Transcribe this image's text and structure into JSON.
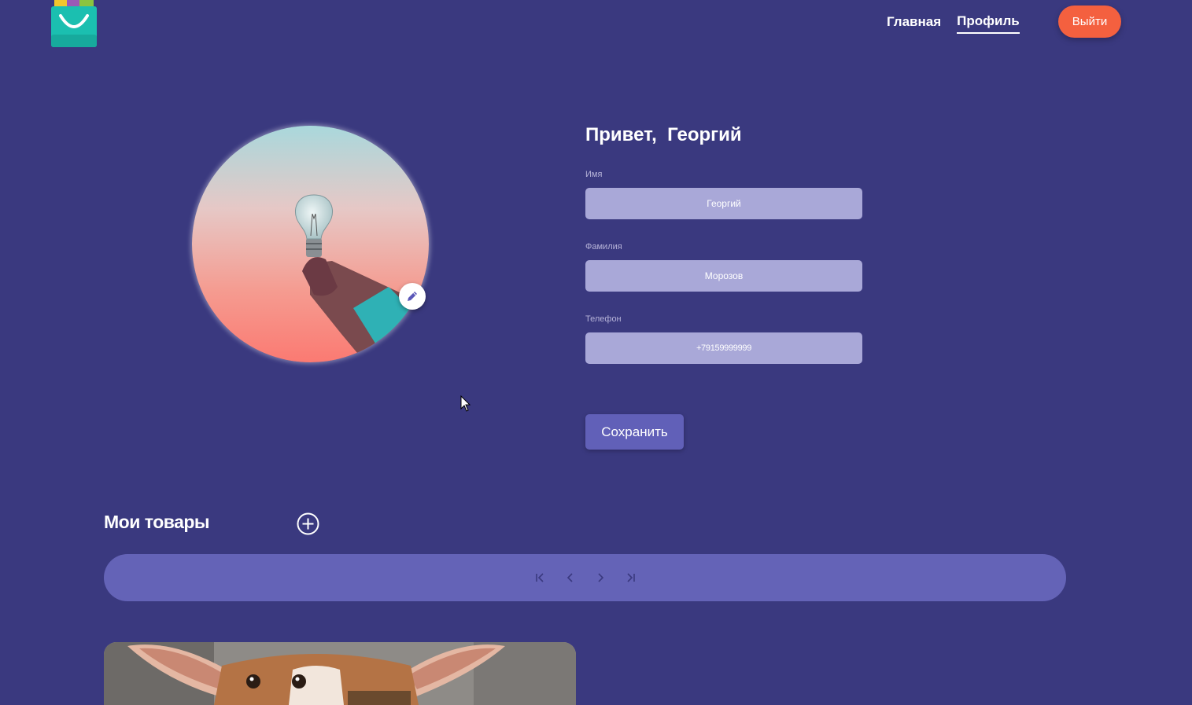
{
  "header": {
    "nav": [
      {
        "label": "Главная",
        "active": false
      },
      {
        "label": "Профиль",
        "active": true
      }
    ],
    "logout_label": "Выйти"
  },
  "profile": {
    "greeting_prefix": "Привет,",
    "user_name": "Георгий",
    "fields": [
      {
        "label": "Имя",
        "value": "Георгий"
      },
      {
        "label": "Фамилия",
        "value": "Морозов"
      },
      {
        "label": "Телефон",
        "value": "+79159999999"
      }
    ],
    "save_label": "Сохранить"
  },
  "goods": {
    "title": "Мои товары"
  },
  "icons": {
    "logo": "shopping-bag-icon",
    "edit": "pencil-icon",
    "add": "plus-circle-icon",
    "pager": [
      "first-page-icon",
      "prev-page-icon",
      "next-page-icon",
      "last-page-icon"
    ]
  },
  "colors": {
    "background": "#3a397f",
    "accent": "#f4603f",
    "input_bg": "#a9a8d8",
    "button": "#6160b8",
    "pager_bg": "#6463b7"
  }
}
